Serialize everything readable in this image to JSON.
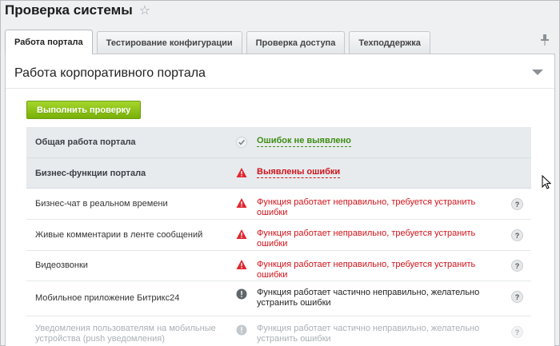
{
  "header": {
    "title": "Проверка системы",
    "star_icon": "star-icon"
  },
  "tabs": [
    {
      "label": "Работа портала",
      "active": true
    },
    {
      "label": "Тестирование конфигурации",
      "active": false
    },
    {
      "label": "Проверка доступа",
      "active": false
    },
    {
      "label": "Техподдержка",
      "active": false
    }
  ],
  "section": {
    "title": "Работа корпоративного портала"
  },
  "run_button": {
    "label": "Выполнить проверку"
  },
  "rows": [
    {
      "label": "Общая работа портала",
      "status": "Ошибок не выявлено",
      "icon": "check-icon"
    },
    {
      "label": "Бизнес-функции портала",
      "status": "Выявлены ошибки",
      "icon": "warning-icon"
    },
    {
      "label": "Бизнес-чат в реальном времени",
      "status": "Функция работает неправильно, требуется устранить ошибки",
      "icon": "warning-icon"
    },
    {
      "label": "Живые комментарии в ленте сообщений",
      "status": "Функция работает неправильно, требуется устранить ошибки",
      "icon": "warning-icon"
    },
    {
      "label": "Видеозвонки",
      "status": "Функция работает неправильно, требуется устранить ошибки",
      "icon": "warning-icon"
    },
    {
      "label": "Мобильное приложение Битрикс24",
      "status": "Функция работает частично неправильно, желательно устранить ошибки",
      "icon": "info-icon"
    },
    {
      "label": "Уведомления пользователям на мобильные устройства (push уведомления)",
      "status": "Функция работает частично неправильно, желательно устранить ошибки",
      "icon": "info-icon"
    }
  ],
  "help_label": "?",
  "colors": {
    "ok": "#3c8d12",
    "error": "#d0131a",
    "accent_green": "#79b007"
  }
}
